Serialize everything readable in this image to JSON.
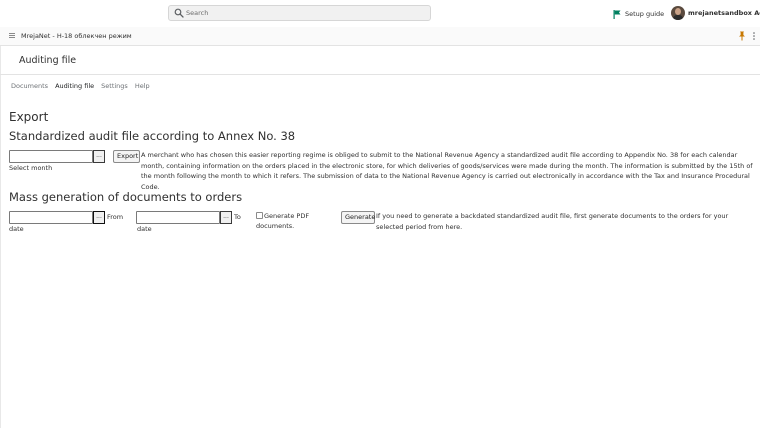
{
  "topbar": {
    "search_placeholder": "Search",
    "setup_guide": "Setup guide",
    "user_name": "mrejanetsandbox Admin"
  },
  "breadcrumb": {
    "text": "MrejaNet - Н-18 облекчен режим"
  },
  "page": {
    "title": "Auditing file"
  },
  "tabs": [
    {
      "label": "Documents",
      "active": false
    },
    {
      "label": "Auditing file",
      "active": true
    },
    {
      "label": "Settings",
      "active": false
    },
    {
      "label": "Help",
      "active": false
    }
  ],
  "export_section": {
    "heading": "Export",
    "subheading": "Standardized audit file according to Annex No. 38",
    "month_value": "",
    "month_picker_label": "...",
    "month_label": "Select month",
    "export_button": "Export",
    "description": "A merchant who has chosen this easier reporting regime is obliged to submit to the National Revenue Agency a standardized audit file according to Appendix No. 38 for each calendar month, containing information on the orders placed in the electronic store, for which deliveries of goods/services were made during the month. The information is submitted by the 15th of the month following the month to which it refers. The submission of data to the National Revenue Agency is carried out electronically in accordance with the Tax and Insurance Procedural Code."
  },
  "mass_section": {
    "heading": "Mass generation of documents to orders",
    "from_value": "",
    "from_picker_label": "...",
    "from_label_a": "From",
    "from_label_b": "date",
    "to_value": "",
    "to_picker_label": "...",
    "to_label_a": "To",
    "to_label_b": "date",
    "pdf_checked": false,
    "pdf_label_a": "Generate PDF",
    "pdf_label_b": "documents.",
    "generate_button": "Generate",
    "description": "If you need to generate a backdated standardized audit file, first generate documents to the orders for your selected period from here."
  },
  "colors": {
    "accent": "#008060",
    "text": "#303030",
    "border": "#e3e3e3",
    "pin": "#c77700"
  }
}
